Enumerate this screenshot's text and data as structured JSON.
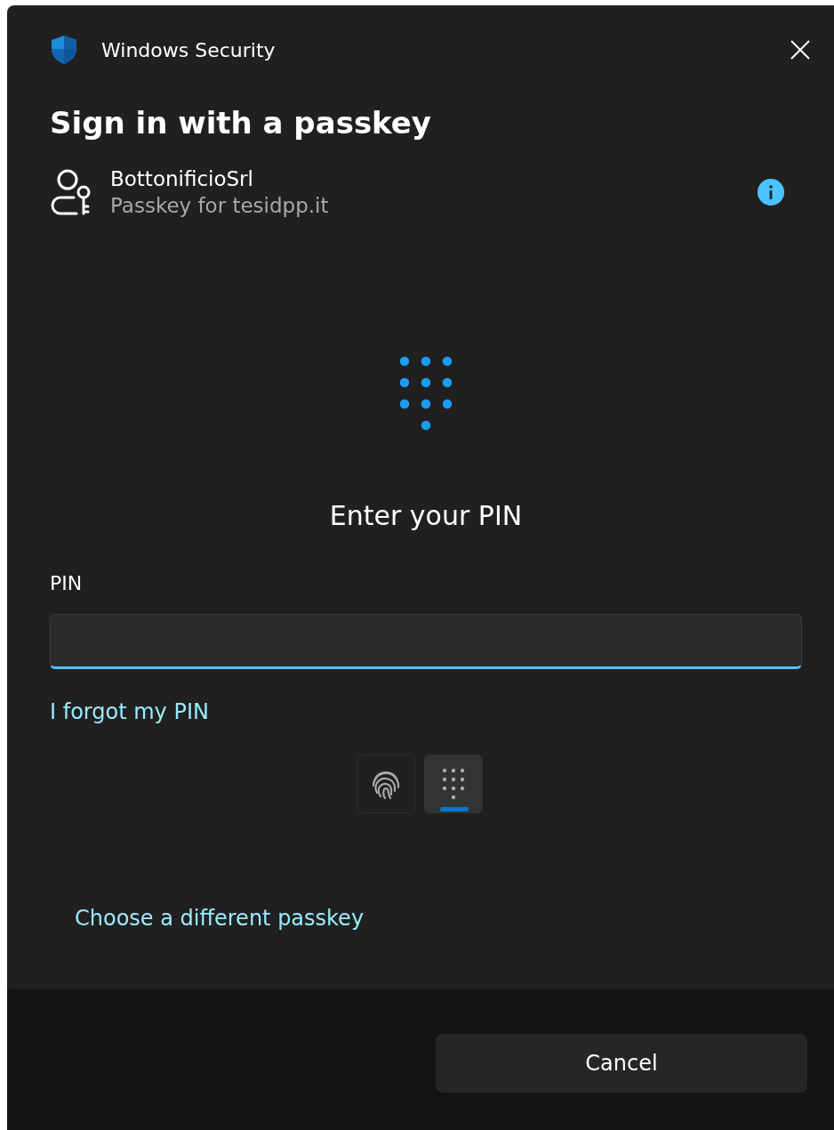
{
  "window": {
    "title": "Windows Security"
  },
  "heading": "Sign in with a passkey",
  "account": {
    "name": "BottonificioSrl",
    "detail": "Passkey for tesidpp.it"
  },
  "prompt": "Enter your PIN",
  "pin_field": {
    "label": "PIN"
  },
  "forgot_link": "I forgot my PIN",
  "methods": [
    {
      "kind": "fingerprint",
      "selected": false
    },
    {
      "kind": "pin",
      "selected": true
    }
  ],
  "other_link": "Choose a different passkey",
  "buttons": [
    "Cancel"
  ]
}
